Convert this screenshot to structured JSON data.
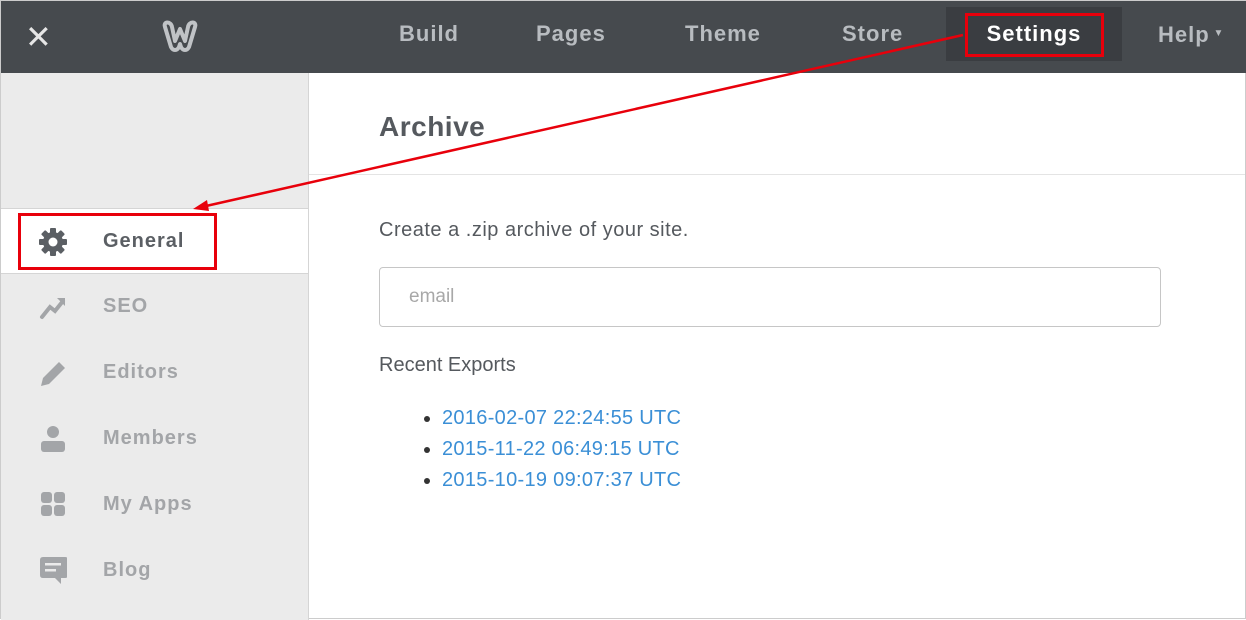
{
  "topbar": {
    "close_icon": "close-icon",
    "logo": "weebly-logo",
    "nav": [
      {
        "label": "Build"
      },
      {
        "label": "Pages"
      },
      {
        "label": "Theme"
      },
      {
        "label": "Store"
      },
      {
        "label": "Settings",
        "active": true
      },
      {
        "label": "Help"
      }
    ]
  },
  "sidebar": {
    "items": [
      {
        "label": "General",
        "icon": "gear-icon",
        "selected": true
      },
      {
        "label": "SEO",
        "icon": "trend-icon"
      },
      {
        "label": "Editors",
        "icon": "pencil-icon"
      },
      {
        "label": "Members",
        "icon": "person-icon"
      },
      {
        "label": "My Apps",
        "icon": "apps-grid-icon"
      },
      {
        "label": "Blog",
        "icon": "comment-icon"
      }
    ]
  },
  "main": {
    "title": "Archive",
    "description": "Create a .zip archive of your site.",
    "email_placeholder": "email",
    "email_value": "",
    "recent_label": "Recent Exports",
    "exports": [
      "2016-02-07 22:24:55 UTC",
      "2015-11-22 06:49:15 UTC",
      "2015-10-19 09:07:37 UTC"
    ]
  },
  "annotation_color": "#e8000b"
}
